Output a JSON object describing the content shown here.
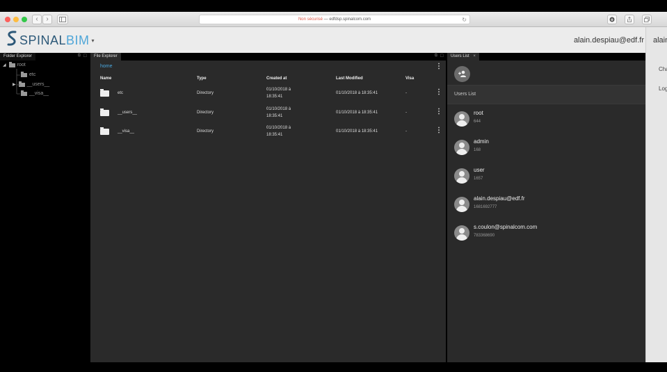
{
  "browser": {
    "address_security": "Non sécurisé",
    "address_sep": "—",
    "address_host": "edfdsp.spinalcom.com"
  },
  "app": {
    "logo_main": "SPINAL",
    "logo_accent": "BIM",
    "user_email": "alain.despiau@edf.fr",
    "right_panel": {
      "name": "alain",
      "items": [
        "Cha",
        "Log"
      ]
    }
  },
  "folder_explorer": {
    "tab": "Folder Explorer",
    "tree": [
      {
        "label": "root",
        "level": 0,
        "expanded": true
      },
      {
        "label": "etc",
        "level": 1
      },
      {
        "label": "__users__",
        "level": 1
      },
      {
        "label": "__visa__",
        "level": 1
      }
    ]
  },
  "file_explorer": {
    "tab": "File Explorer",
    "breadcrumb": "home",
    "columns": [
      "Name",
      "Type",
      "Created at",
      "Last Modified",
      "Visa"
    ],
    "rows": [
      {
        "name": "etc",
        "type": "Directory",
        "created_1": "01/10/2018 à",
        "created_2": "18:35:41",
        "modified": "01/10/2018 à 18:35:41",
        "visa": "-"
      },
      {
        "name": "__users__",
        "type": "Directory",
        "created_1": "01/10/2018 à",
        "created_2": "18:35:41",
        "modified": "01/10/2018 à 18:35:41",
        "visa": "-"
      },
      {
        "name": "__visa__",
        "type": "Directory",
        "created_1": "01/10/2018 à",
        "created_2": "18:35:41",
        "modified": "01/10/2018 à 18:35:41",
        "visa": "-"
      }
    ]
  },
  "users_list": {
    "tab": "Users List",
    "close": "×",
    "title": "Users List",
    "users": [
      {
        "name": "root",
        "id": "644"
      },
      {
        "name": "admin",
        "id": "168"
      },
      {
        "name": "user",
        "id": "1657"
      },
      {
        "name": "alain.despiau@edf.fr",
        "id": "1681692777"
      },
      {
        "name": "s.coulon@spinalcom.com",
        "id": "783368690"
      }
    ]
  },
  "icons": {
    "kebab": "⋮",
    "back": "‹",
    "forward": "›",
    "reload": "↻",
    "add_user": "+👤"
  }
}
